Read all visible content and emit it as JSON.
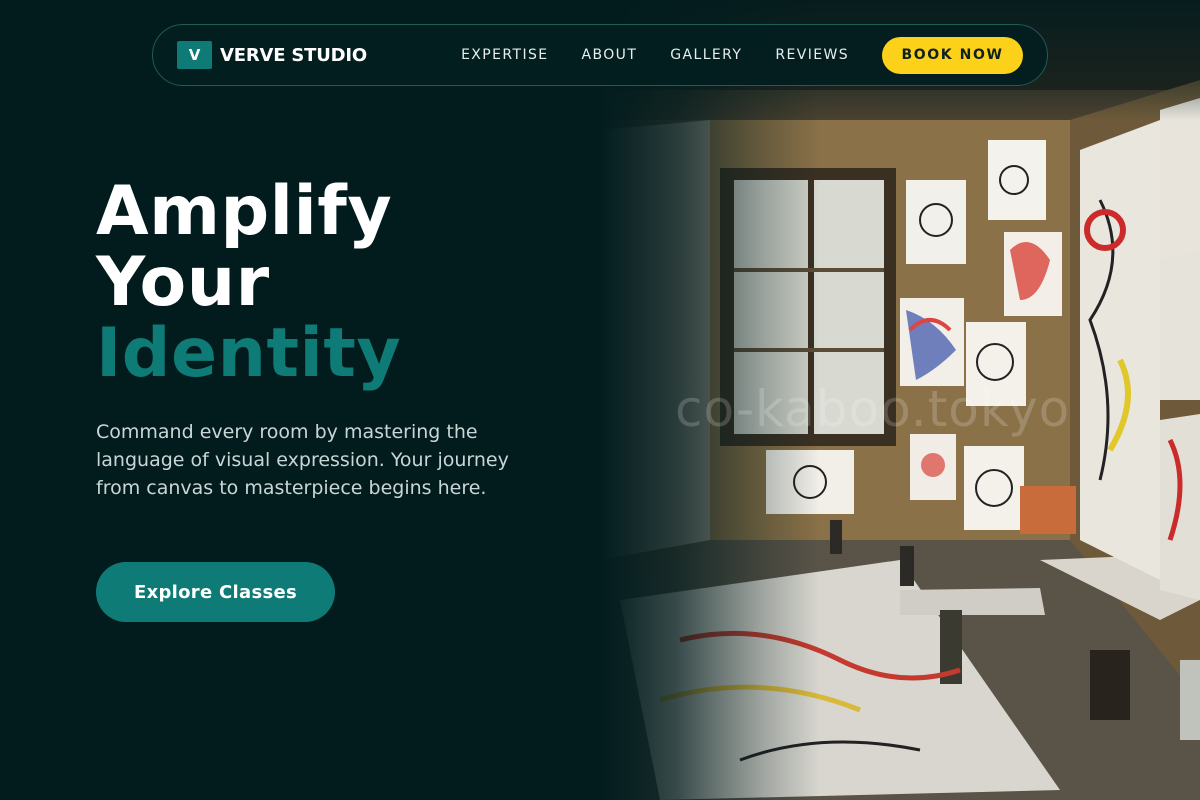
{
  "brand": {
    "mark": "V",
    "name": "VERVE STUDIO"
  },
  "nav": {
    "items": [
      {
        "label": "EXPERTISE"
      },
      {
        "label": "ABOUT"
      },
      {
        "label": "GALLERY"
      },
      {
        "label": "REVIEWS"
      }
    ],
    "cta_label": "BOOK NOW"
  },
  "hero": {
    "title_line1": "Amplify",
    "title_line2": "Your",
    "title_accent": "Identity",
    "subtitle": "Command every room by mastering the language of visual expression. Your journey from canvas to masterpiece begins here.",
    "cta_label": "Explore Classes"
  },
  "photo": {
    "watermark": "co-kaboo.tokyo"
  },
  "colors": {
    "background": "#021c1e",
    "accent": "#0f7b76",
    "cta_yellow": "#fbd11a"
  }
}
